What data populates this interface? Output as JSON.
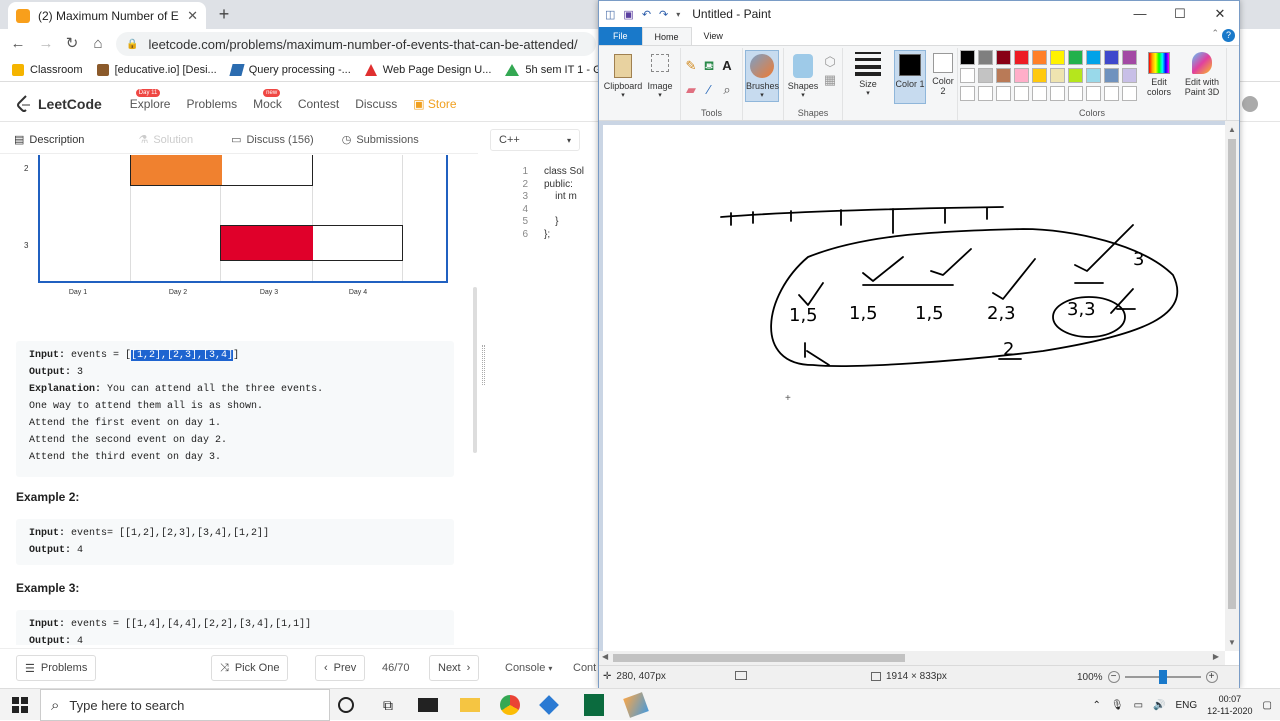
{
  "browser": {
    "tab_title": "(2) Maximum Number of Events",
    "url": "leetcode.com/problems/maximum-number-of-events-that-can-be-attended/",
    "bookmarks": [
      "Classroom",
      "[educative.io] [Desi...",
      "Query processing -...",
      "Web Page Design U...",
      "5h sem IT 1 - Googl..."
    ]
  },
  "leetcode": {
    "logo": "LeetCode",
    "nav": [
      "Explore",
      "Problems",
      "Mock",
      "Contest",
      "Discuss",
      "Store"
    ],
    "explore_badge": "Day 11",
    "mock_badge": "new",
    "tabs": [
      "Description",
      "Solution",
      "Discuss (156)",
      "Submissions"
    ],
    "language": "C++",
    "chart": {
      "ylabels": [
        "2",
        "3"
      ],
      "xlabels": [
        "Day 1",
        "Day 2",
        "Day 3",
        "Day 4"
      ],
      "colors": {
        "orange": "#f0812f",
        "red": "#e0002a",
        "axis": "#2060c0"
      }
    },
    "example1": {
      "input_label": "Input:",
      "input_prefix": "events = [",
      "input_selected": "[1,2],[2,3],[3,4]",
      "input_suffix": "]",
      "output_label": "Output:",
      "output_value": "3",
      "explanation_label": "Explanation:",
      "explanation_text": "You can attend all the three events.",
      "lines": [
        "One way to attend them all is as shown.",
        "Attend the first event on day 1.",
        "Attend the second event on day 2.",
        "Attend the third event on day 3."
      ]
    },
    "example2": {
      "heading": "Example 2:",
      "input_label": "Input:",
      "input_value": "events= [[1,2],[2,3],[3,4],[1,2]]",
      "output_label": "Output:",
      "output_value": "4"
    },
    "example3": {
      "heading": "Example 3:",
      "input_label": "Input:",
      "input_value": "events = [[1,4],[4,4],[2,2],[3,4],[1,1]]",
      "output_label": "Output:",
      "output_value": "4"
    },
    "editor_lines": [
      {
        "n": "1",
        "text": "class Sol"
      },
      {
        "n": "2",
        "text": "public:"
      },
      {
        "n": "3",
        "text": "    int m"
      },
      {
        "n": "4",
        "text": ""
      },
      {
        "n": "5",
        "text": "    }"
      },
      {
        "n": "6",
        "text": "};"
      }
    ],
    "bottom": {
      "problems": "Problems",
      "pick_one": "Pick One",
      "prev": "Prev",
      "page": "46/70",
      "next": "Next",
      "console": "Console",
      "contribute": "Cont"
    }
  },
  "paint": {
    "title": "Untitled - Paint",
    "ribbon_tabs": [
      "File",
      "Home",
      "View"
    ],
    "groups": {
      "clipboard": "Clipboard",
      "image": "Image",
      "tools": "Tools",
      "brushes": "Brushes",
      "shapes_btn": "Shapes",
      "shapes_group": "Shapes",
      "size": "Size",
      "color1": "Color 1",
      "color2": "Color 2",
      "colors_group": "Colors",
      "edit_colors": "Edit colors",
      "paint3d": "Edit with Paint 3D"
    },
    "palette_row1": [
      "#000000",
      "#7f7f7f",
      "#880015",
      "#ed1c24",
      "#ff7f27",
      "#fff200",
      "#22b14c",
      "#00a2e8",
      "#3f48cc",
      "#a349a4"
    ],
    "palette_row2": [
      "#ffffff",
      "#c3c3c3",
      "#b97a57",
      "#ffaec9",
      "#ffc90e",
      "#efe4b0",
      "#b5e61d",
      "#99d9ea",
      "#7092be",
      "#c8bfe7"
    ],
    "drawing_labels": [
      "1,5",
      "1,5",
      "1,5",
      "2,3",
      "3,3",
      "3",
      "2"
    ],
    "status": {
      "cursor": "280, 407px",
      "canvas_size": "1914 × 833px",
      "zoom": "100%"
    }
  },
  "taskbar": {
    "search_placeholder": "Type here to search",
    "lang": "ENG",
    "time": "00:07",
    "date": "12-11-2020"
  }
}
